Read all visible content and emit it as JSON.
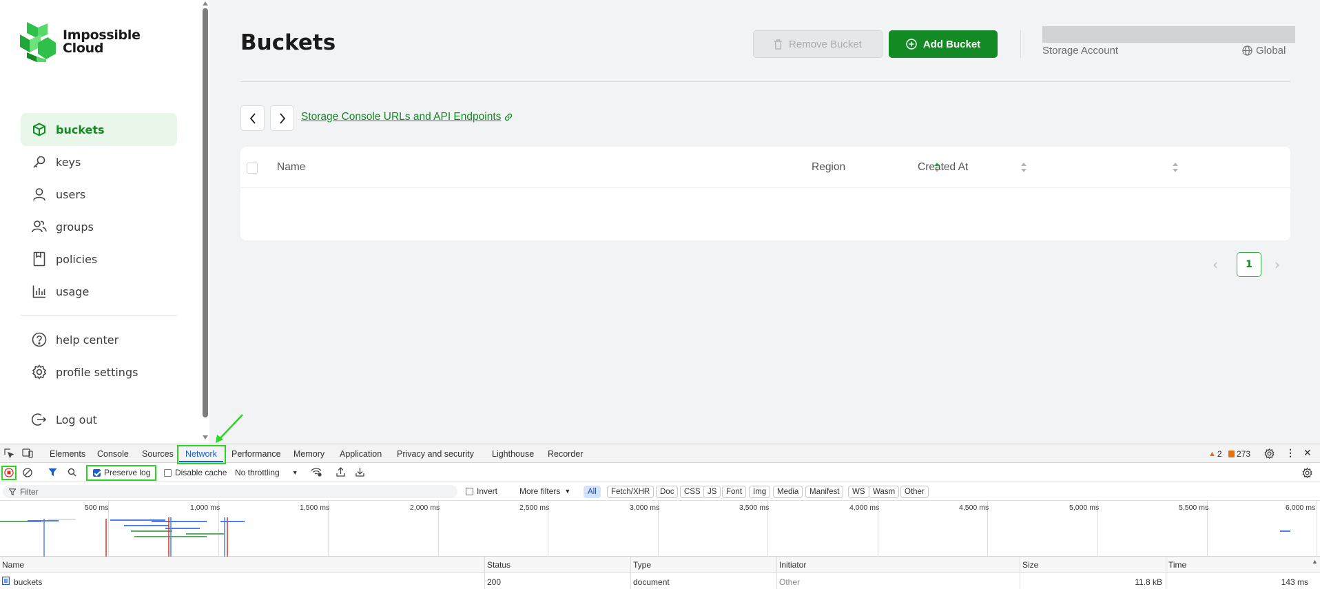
{
  "brand": {
    "name_line1": "Impossible",
    "name_line2": "Cloud"
  },
  "sidebar": {
    "items": [
      {
        "label": "buckets",
        "icon": "cube-icon",
        "active": true
      },
      {
        "label": "keys",
        "icon": "key-icon"
      },
      {
        "label": "users",
        "icon": "user-icon"
      },
      {
        "label": "groups",
        "icon": "users-icon"
      },
      {
        "label": "policies",
        "icon": "file-icon"
      },
      {
        "label": "usage",
        "icon": "bar-chart-icon"
      }
    ],
    "secondary": [
      {
        "label": "help center",
        "icon": "help-circle-icon"
      },
      {
        "label": "profile settings",
        "icon": "gear-icon"
      }
    ],
    "logout": {
      "label": "Log out",
      "icon": "logout-icon"
    }
  },
  "header": {
    "title": "Buckets",
    "remove_label": "Remove Bucket",
    "add_label": "Add Bucket",
    "account_label": "Storage Account",
    "region_label": "Global"
  },
  "links": {
    "console": "Storage Console URLs and API Endpoints"
  },
  "table": {
    "columns": [
      "Name",
      "Region",
      "Created At"
    ],
    "rows": []
  },
  "pagination": {
    "current": "1"
  },
  "devtools": {
    "tabs": [
      "Elements",
      "Console",
      "Sources",
      "Network",
      "Performance",
      "Memory",
      "Application",
      "Privacy and security",
      "Lighthouse",
      "Recorder"
    ],
    "active_tab": "Network",
    "warnings": "2",
    "issues": "273",
    "toolbar": {
      "preserve_log": "Preserve log",
      "disable_cache": "Disable cache",
      "throttling": "No throttling"
    },
    "filter": {
      "placeholder": "Filter",
      "invert": "Invert",
      "more_filters": "More filters",
      "types": [
        "All",
        "Fetch/XHR",
        "Doc",
        "CSS",
        "JS",
        "Font",
        "Img",
        "Media",
        "Manifest",
        "WS",
        "Wasm",
        "Other"
      ]
    },
    "timeline_ticks": [
      "500 ms",
      "1,000 ms",
      "1,500 ms",
      "2,000 ms",
      "2,500 ms",
      "3,000 ms",
      "3,500 ms",
      "4,000 ms",
      "4,500 ms",
      "5,000 ms",
      "5,500 ms",
      "6,000 ms"
    ],
    "columns": [
      "Name",
      "Status",
      "Type",
      "Initiator",
      "Size",
      "Time"
    ],
    "requests": [
      {
        "name": "buckets",
        "status": "200",
        "type": "document",
        "initiator": "Other",
        "size": "11.8 kB",
        "time": "143 ms"
      }
    ]
  },
  "colors": {
    "brand_green": "#138a23",
    "active_bg": "#e9f6ea",
    "devtools_blue": "#1a5fd1",
    "highlight_green": "#2ad621"
  }
}
